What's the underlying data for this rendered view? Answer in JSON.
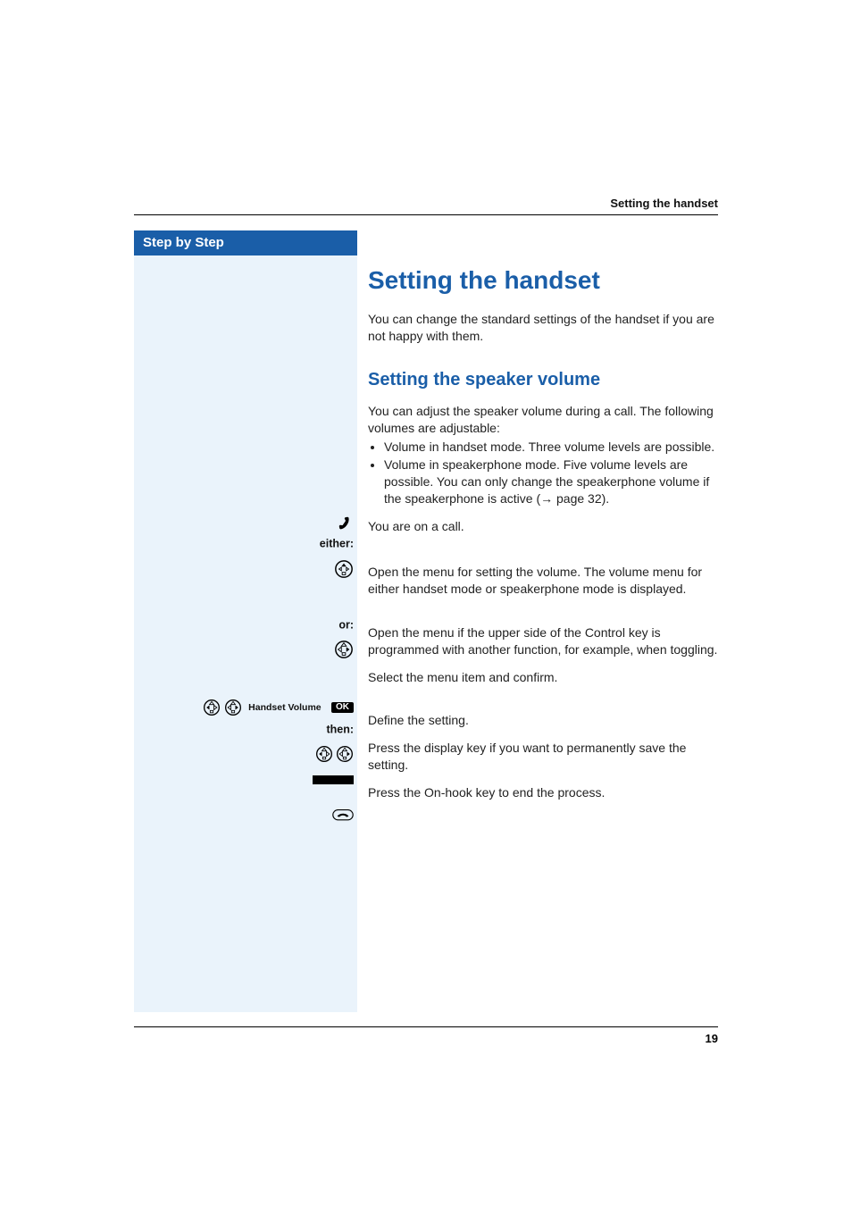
{
  "header": {
    "running_head": "Setting the handset"
  },
  "sidebar": {
    "title": "Step by Step"
  },
  "main": {
    "h1": "Setting the handset",
    "intro": "You can change the standard settings of the handset if you are not happy with them.",
    "h2": "Setting the speaker volume",
    "desc": "You can adjust the speaker volume during a call. The following volumes are adjustable:",
    "bullet1": "Volume in handset mode. Three volume levels are possible.",
    "bullet2_pre": "Volume in speakerphone mode. Five volume levels are possible. You can only change the speakerphone volume if the speakerphone is active (",
    "bullet2_ref": "→ page 32",
    "bullet2_post": ").",
    "on_call": "You are on a call.",
    "either": "either:",
    "open_menu_1": "Open the menu for setting the volume. The volume menu for either handset mode or speakerphone mode is displayed.",
    "or": "or:",
    "open_menu_2": "Open the menu if the upper side of the Control key is programmed with another function, for example, when toggling.",
    "select_confirm": "Select the menu item and confirm.",
    "then": "then:",
    "define": "Define the setting.",
    "save": "Press the display key if you want to permanently save the setting.",
    "end": "Press the On-hook key to end the process.",
    "menu_item": "Handset Volume",
    "ok": "OK"
  },
  "footer": {
    "page": "19"
  }
}
